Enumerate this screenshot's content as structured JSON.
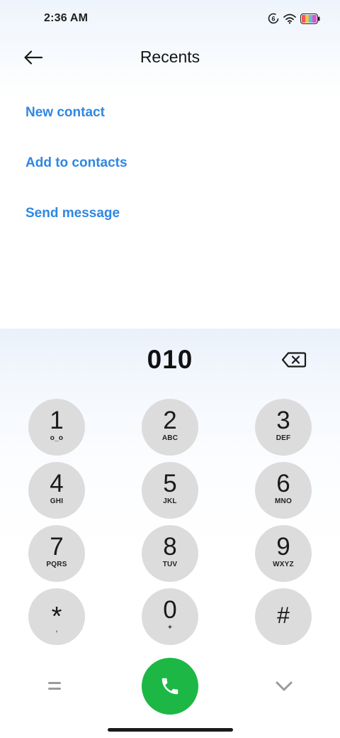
{
  "status_bar": {
    "time": "2:36 AM",
    "icons": [
      "data-saver-icon",
      "wifi-icon",
      "battery-icon"
    ],
    "data_saver_badge": "6"
  },
  "header": {
    "title": "Recents",
    "back_icon": "arrow-left-icon"
  },
  "actions": {
    "new_contact": "New contact",
    "add_to_contacts": "Add to contacts",
    "send_message": "Send message"
  },
  "dialer": {
    "number": "010",
    "backspace_icon": "backspace-icon",
    "keys": [
      {
        "digit": "1",
        "letters": "o_o"
      },
      {
        "digit": "2",
        "letters": "ABC"
      },
      {
        "digit": "3",
        "letters": "DEF"
      },
      {
        "digit": "4",
        "letters": "GHI"
      },
      {
        "digit": "5",
        "letters": "JKL"
      },
      {
        "digit": "6",
        "letters": "MNO"
      },
      {
        "digit": "7",
        "letters": "PQRS"
      },
      {
        "digit": "8",
        "letters": "TUV"
      },
      {
        "digit": "9",
        "letters": "WXYZ"
      },
      {
        "digit": "*",
        "letters": ","
      },
      {
        "digit": "0",
        "letters": "+"
      },
      {
        "digit": "#",
        "letters": ""
      }
    ]
  },
  "bottom_bar": {
    "menu_icon": "equals-menu-icon",
    "call_icon": "phone-icon",
    "collapse_icon": "chevron-down-icon"
  },
  "colors": {
    "accent": "#2f87e2",
    "call_green": "#1db745",
    "key_bg": "#dcdcdc"
  }
}
